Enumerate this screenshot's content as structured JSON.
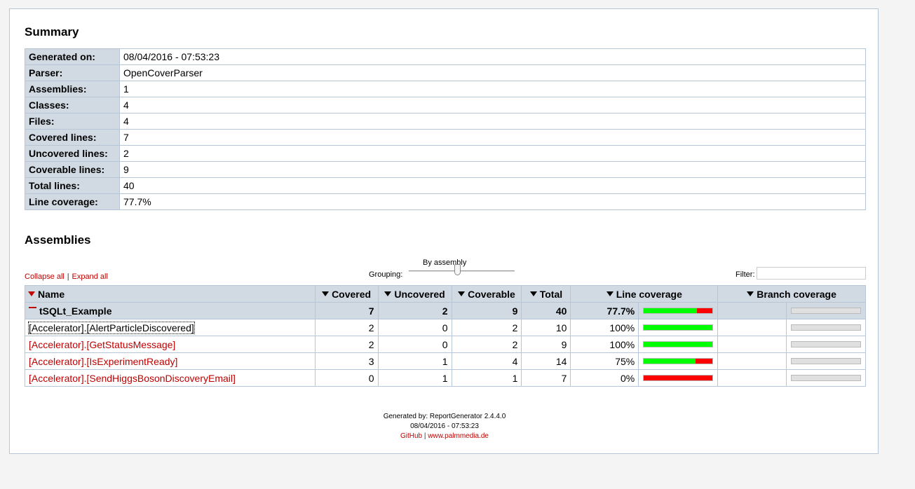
{
  "summary": {
    "heading": "Summary",
    "rows": [
      {
        "label": "Generated on:",
        "value": "08/04/2016 - 07:53:23"
      },
      {
        "label": "Parser:",
        "value": "OpenCoverParser"
      },
      {
        "label": "Assemblies:",
        "value": "1"
      },
      {
        "label": "Classes:",
        "value": "4"
      },
      {
        "label": "Files:",
        "value": "4"
      },
      {
        "label": "Covered lines:",
        "value": "7"
      },
      {
        "label": "Uncovered lines:",
        "value": "2"
      },
      {
        "label": "Coverable lines:",
        "value": "9"
      },
      {
        "label": "Total lines:",
        "value": "40"
      },
      {
        "label": "Line coverage:",
        "value": "77.7%"
      }
    ]
  },
  "assemblies": {
    "heading": "Assemblies",
    "collapse_all": "Collapse all",
    "separator": "|",
    "expand_all": "Expand all",
    "grouping_label": "Grouping:",
    "grouping_value": "By assembly",
    "grouping_level": 0.46,
    "filter_label": "Filter:",
    "filter_value": "",
    "columns": {
      "name": "Name",
      "covered": "Covered",
      "uncovered": "Uncovered",
      "coverable": "Coverable",
      "total": "Total",
      "line_coverage": "Line coverage",
      "branch_coverage": "Branch coverage"
    },
    "group": {
      "name": "tSQLt_Example",
      "covered": "7",
      "uncovered": "2",
      "coverable": "9",
      "total": "40",
      "line_coverage": "77.7%",
      "coverage_fraction": 0.777
    },
    "classes": [
      {
        "name": "[Accelerator].[AlertParticleDiscovered]",
        "covered": "2",
        "uncovered": "0",
        "coverable": "2",
        "total": "10",
        "line_coverage": "100%",
        "coverage_fraction": 1.0
      },
      {
        "name": "[Accelerator].[GetStatusMessage]",
        "covered": "2",
        "uncovered": "0",
        "coverable": "2",
        "total": "9",
        "line_coverage": "100%",
        "coverage_fraction": 1.0
      },
      {
        "name": "[Accelerator].[IsExperimentReady]",
        "covered": "3",
        "uncovered": "1",
        "coverable": "4",
        "total": "14",
        "line_coverage": "75%",
        "coverage_fraction": 0.75
      },
      {
        "name": "[Accelerator].[SendHiggsBosonDiscoveryEmail]",
        "covered": "0",
        "uncovered": "1",
        "coverable": "1",
        "total": "7",
        "line_coverage": "0%",
        "coverage_fraction": 0.0
      }
    ]
  },
  "footer": {
    "generated_by": "Generated by: ReportGenerator 2.4.4.0",
    "date": "08/04/2016 - 07:53:23",
    "github": "GitHub",
    "separator": "|",
    "website": "www.palmmedia.de"
  },
  "colors": {
    "covered": "#00ff00",
    "uncovered": "#ff0000",
    "link": "#c00000",
    "header_bg": "#d1dae3",
    "border": "#b6c6d6"
  }
}
